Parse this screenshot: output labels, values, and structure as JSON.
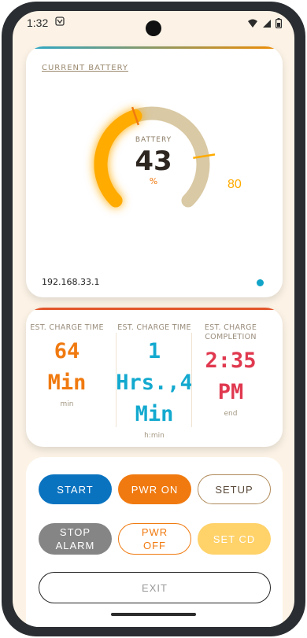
{
  "status": {
    "time": "1:32"
  },
  "battery": {
    "title": "CURRENT BATTERY",
    "label": "BATTERY",
    "value": "43",
    "unit": "%",
    "limit": "80",
    "level_fraction": 0.43,
    "limit_fraction": 0.8,
    "ip": "192.168.33.1"
  },
  "estimates": [
    {
      "label": "EST. CHARGE TIME",
      "value_lines": [
        "64",
        "Min"
      ],
      "unit": "min",
      "color": "#f07a10",
      "underline": false
    },
    {
      "label": "EST. CHARGE TIME",
      "value_lines": [
        "1",
        "Hrs.,4",
        "Min"
      ],
      "unit": "h:min",
      "color": "#13a9cf",
      "underline": false
    },
    {
      "label": "EST. CHARGE COMPLETION",
      "value_lines": [
        "2:35",
        "PM"
      ],
      "unit": "end",
      "color": "#e0394f",
      "underline": true
    }
  ],
  "controls": {
    "start": "START",
    "pwr_on": "PWR ON",
    "setup": "SETUP",
    "stop_alarm": "STOP ALARM",
    "pwr_off": "PWR OFF",
    "set_cd": "SET CD",
    "exit": "EXIT"
  },
  "colors": {
    "accent_orange": "#f07a10",
    "accent_blue": "#0a73c0",
    "gauge_track": "#d9c9a4",
    "gauge_fill": "#ffab00"
  }
}
